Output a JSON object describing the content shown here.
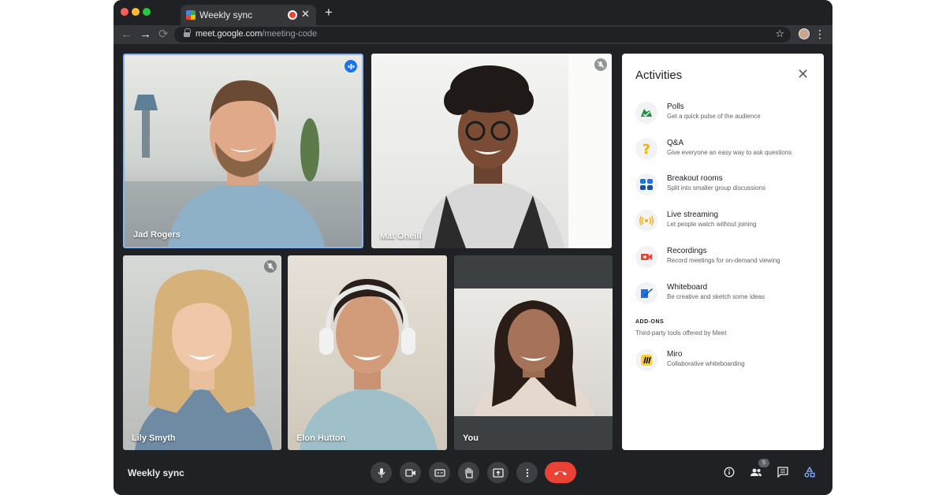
{
  "browser": {
    "tab_title": "Weekly sync",
    "tab_close": "✕",
    "new_tab": "+",
    "url_host": "meet.google.com",
    "url_path": "/meeting-code",
    "nav": {
      "back": "←",
      "forward": "→",
      "reload": "⟳"
    },
    "star": "☆",
    "menu": "⋮"
  },
  "participants": [
    {
      "name": "Jad Rogers",
      "status": "speaking",
      "icon": "audio-level-icon"
    },
    {
      "name": "Mat Oneill",
      "status": "muted",
      "icon": "mic-off-icon"
    },
    {
      "name": "Lily Smyth",
      "status": "muted",
      "icon": "mic-off-icon"
    },
    {
      "name": "Elon Hutton",
      "status": "none"
    },
    {
      "name": "You",
      "status": "none"
    }
  ],
  "activities": {
    "title": "Activities",
    "close": "✕",
    "items": [
      {
        "label": "Polls",
        "desc": "Get a quick pulse of the audience",
        "icon": "polls-icon"
      },
      {
        "label": "Q&A",
        "desc": "Give everyone an easy way to ask questions",
        "icon": "question-icon"
      },
      {
        "label": "Breakout rooms",
        "desc": "Split into smaller group discussions",
        "icon": "breakout-rooms-icon"
      },
      {
        "label": "Live streaming",
        "desc": "Let people watch without joining",
        "icon": "live-streaming-icon"
      },
      {
        "label": "Recordings",
        "desc": "Record meetings for on-demand viewing",
        "icon": "recording-icon"
      },
      {
        "label": "Whiteboard",
        "desc": "Be creative and sketch some ideas",
        "icon": "whiteboard-icon"
      }
    ],
    "addons_heading": "ADD-ONS",
    "addons_desc": "Third-party tools offered by Meet",
    "addons": [
      {
        "label": "Miro",
        "desc": "Collaborative whiteboarding",
        "icon": "miro-icon"
      }
    ]
  },
  "meeting": {
    "title": "Weekly sync",
    "people_count": "5",
    "controls": [
      "mic-icon",
      "camera-icon",
      "captions-icon",
      "raise-hand-icon",
      "present-icon",
      "more-options-icon"
    ]
  },
  "colors": {
    "accent": "#1a73e8",
    "end_call": "#ea4335",
    "background": "#202124"
  }
}
